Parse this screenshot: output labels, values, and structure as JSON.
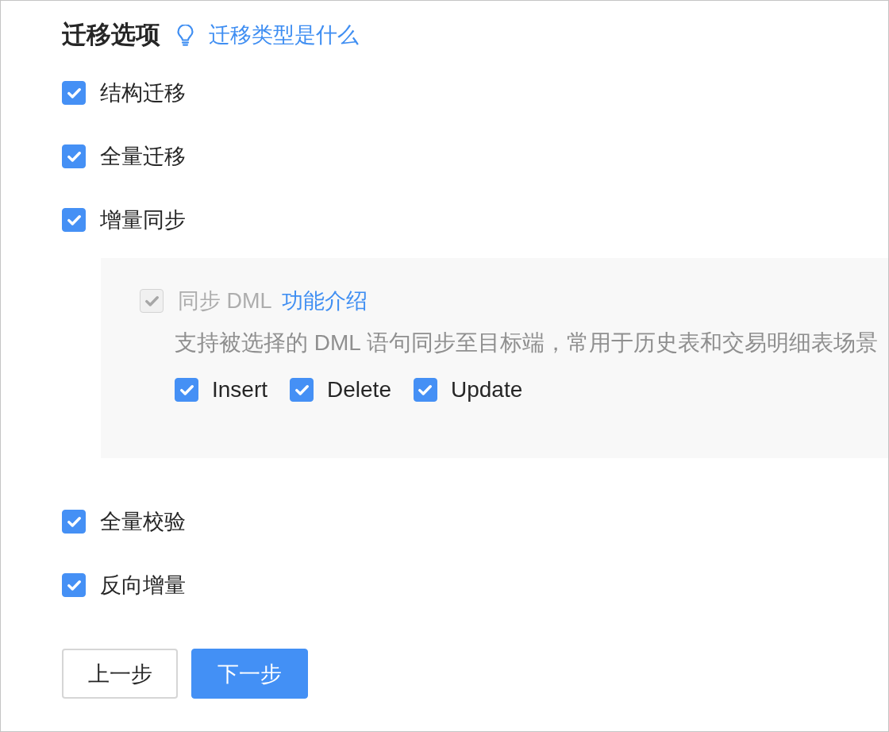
{
  "section": {
    "title": "迁移选项",
    "help_link": "迁移类型是什么"
  },
  "options": [
    {
      "label": "结构迁移",
      "checked": true
    },
    {
      "label": "全量迁移",
      "checked": true
    },
    {
      "label": "增量同步",
      "checked": true,
      "settings": {
        "dml": {
          "label": "同步 DML",
          "link": "功能介绍",
          "checked": true,
          "disabled": true
        },
        "description": "支持被选择的 DML 语句同步至目标端，常用于历史表和交易明细表场景",
        "statements": [
          {
            "label": "Insert",
            "checked": true
          },
          {
            "label": "Delete",
            "checked": true
          },
          {
            "label": "Update",
            "checked": true
          }
        ]
      }
    },
    {
      "label": "全量校验",
      "checked": true
    },
    {
      "label": "反向增量",
      "checked": true
    }
  ],
  "buttons": [
    {
      "label": "上一步",
      "kind": "secondary"
    },
    {
      "label": "下一步",
      "kind": "primary"
    }
  ]
}
